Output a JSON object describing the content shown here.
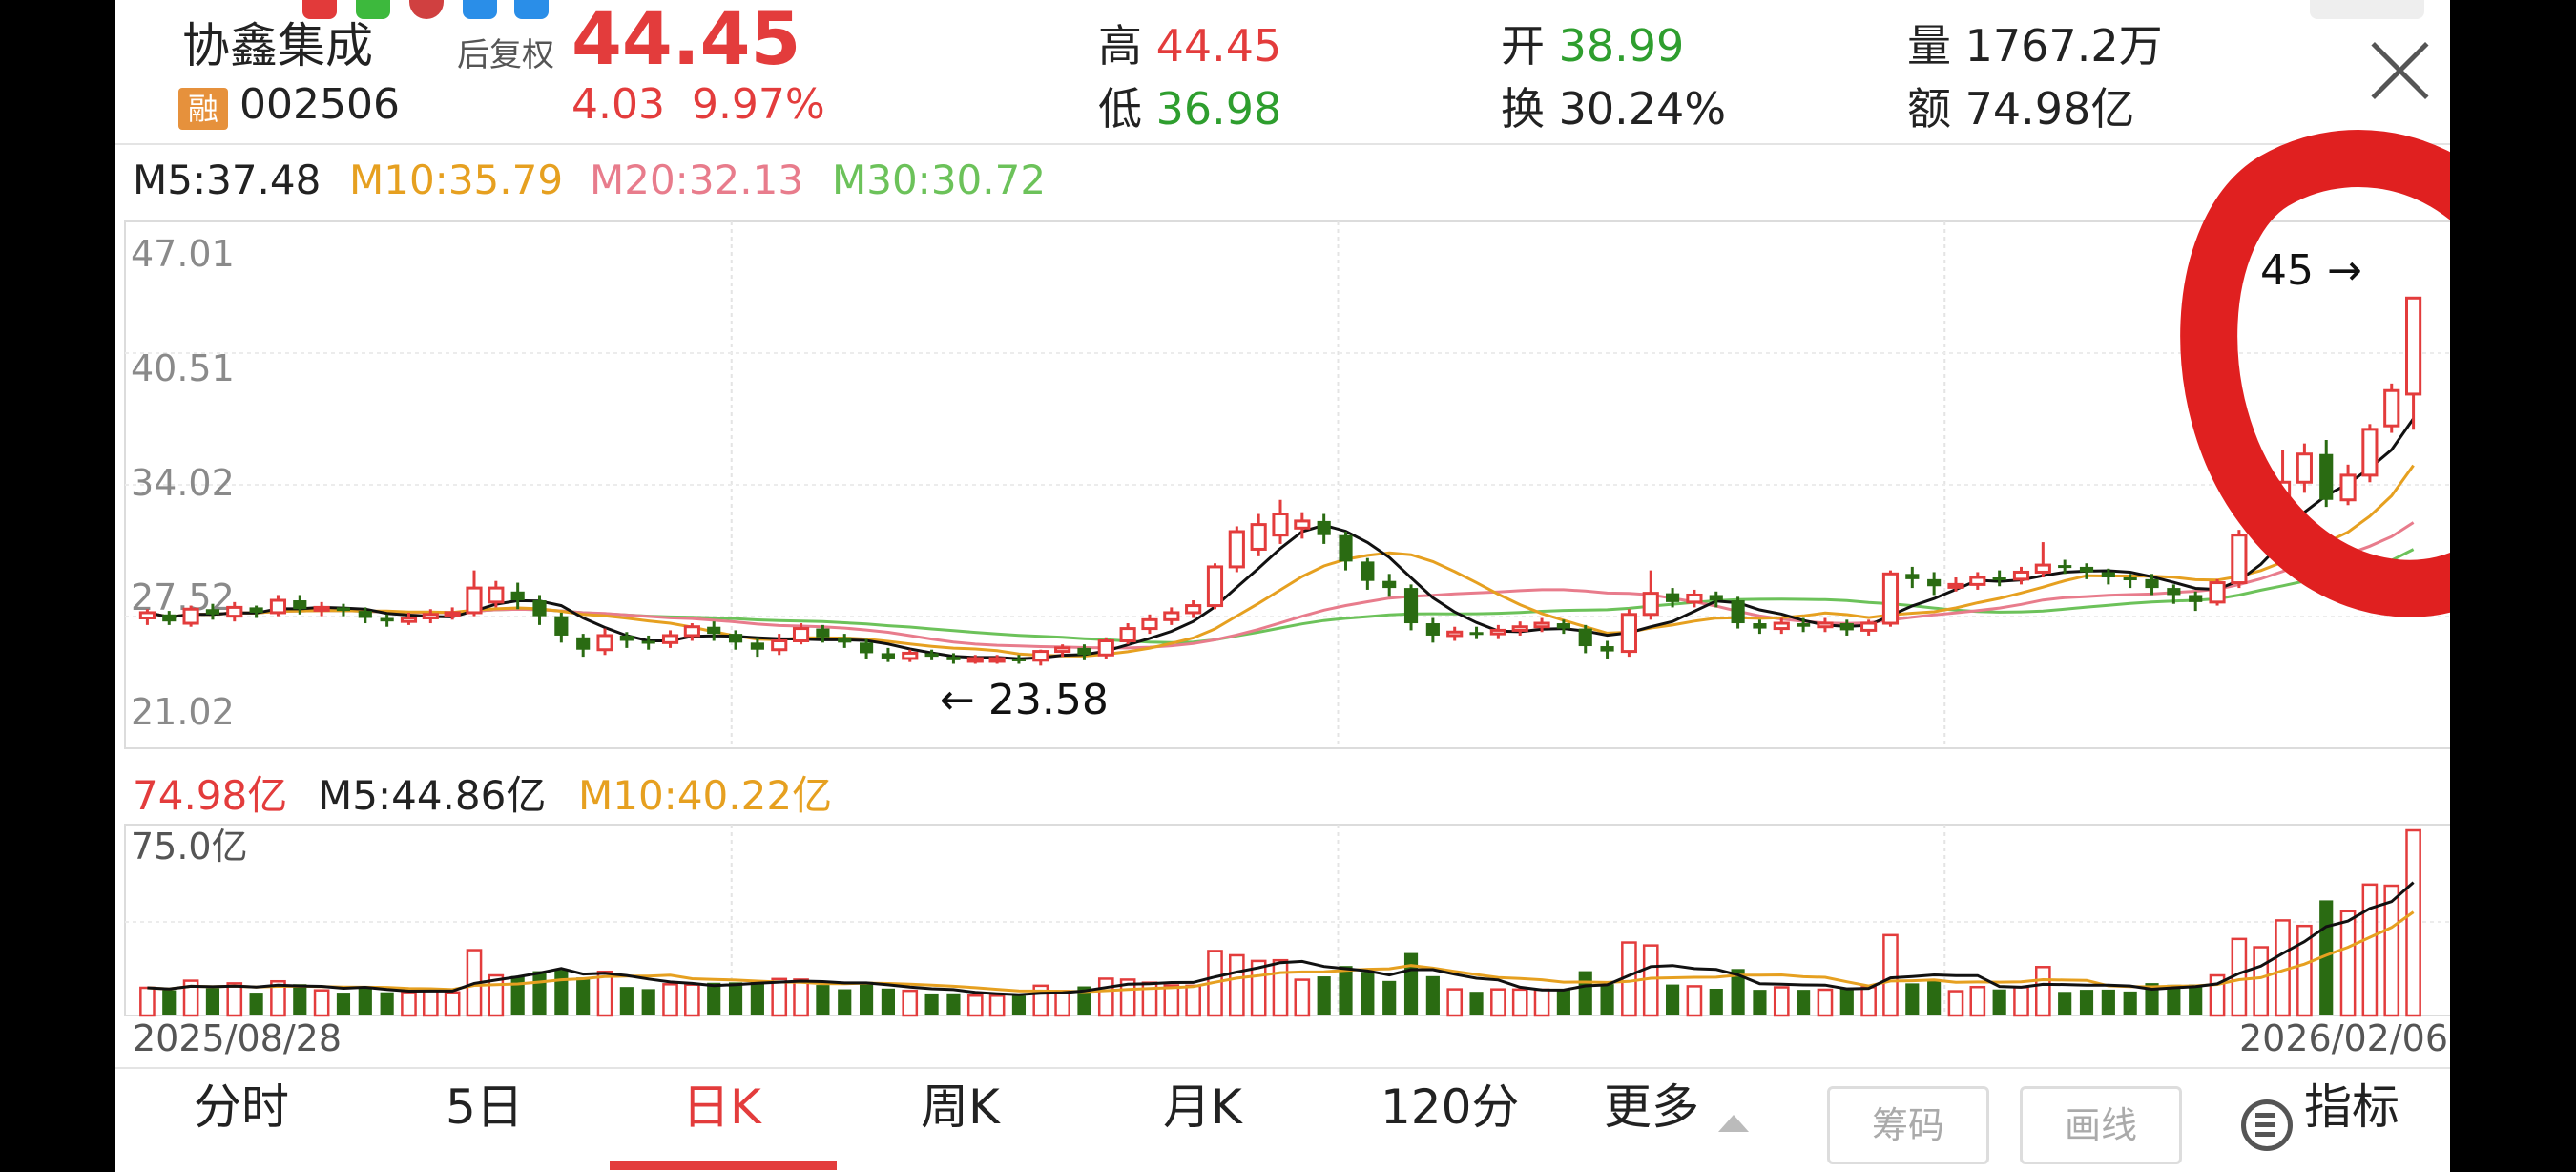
{
  "stock": {
    "name": "协鑫集成",
    "rong": "融",
    "code": "002506",
    "adjust_mode": "后复权",
    "price": "44.45",
    "change": "4.03",
    "change_pct": "9.97%"
  },
  "quote": {
    "high_label": "高",
    "high": "44.45",
    "low_label": "低",
    "low": "36.98",
    "open_label": "开",
    "open": "38.99",
    "turnover_label": "换",
    "turnover": "30.24%",
    "volume_label": "量",
    "volume": "1767.2万",
    "amount_label": "额",
    "amount": "74.98亿"
  },
  "ma_price": {
    "m5": "M5:37.48",
    "m10": "M10:35.79",
    "m20": "M20:32.13",
    "m30": "M30:30.72"
  },
  "chart_axis": {
    "y_ticks": [
      "47.01",
      "40.51",
      "34.02",
      "27.52",
      "21.02"
    ],
    "min_marker": "← 23.58",
    "max_marker": "45 →",
    "vol_max": "75.0亿",
    "date_start": "2025/08/28",
    "date_end": "2026/02/06"
  },
  "volume_ma": {
    "current": "74.98亿",
    "m5": "M5:44.86亿",
    "m10": "M10:40.22亿"
  },
  "colors": {
    "up": "#e33c3c",
    "down": "#2a6b12",
    "ma5": "#111111",
    "ma10": "#e6a020",
    "ma20": "#e87c8c",
    "ma30": "#6cc25a",
    "annotation": "#e02020"
  },
  "tabs": [
    {
      "label": "分时"
    },
    {
      "label": "5日"
    },
    {
      "label": "日K"
    },
    {
      "label": "周K"
    },
    {
      "label": "月K"
    },
    {
      "label": "120分"
    },
    {
      "label": "更多"
    }
  ],
  "buttons": {
    "chips": "筹码",
    "draw": "画线",
    "indicator": "指标"
  },
  "chart_data": {
    "type": "candlestick",
    "x_range": [
      "2025/08/28",
      "2026/02/06"
    ],
    "ylim": [
      21.02,
      47.01
    ],
    "candles": [
      [
        26.3,
        26.6,
        25.9,
        26.8
      ],
      [
        26.5,
        26.1,
        25.9,
        26.7
      ],
      [
        26.0,
        26.8,
        25.8,
        27.0
      ],
      [
        26.8,
        26.5,
        26.2,
        27.1
      ],
      [
        26.4,
        26.9,
        26.1,
        27.2
      ],
      [
        26.9,
        26.6,
        26.3,
        27.0
      ],
      [
        26.6,
        27.3,
        26.4,
        27.6
      ],
      [
        27.3,
        26.8,
        26.5,
        27.6
      ],
      [
        26.8,
        26.9,
        26.4,
        27.2
      ],
      [
        26.9,
        26.7,
        26.4,
        27.1
      ],
      [
        26.7,
        26.3,
        26.0,
        26.9
      ],
      [
        26.3,
        26.1,
        25.8,
        26.5
      ],
      [
        26.1,
        26.3,
        25.9,
        26.6
      ],
      [
        26.3,
        26.5,
        26.0,
        26.8
      ],
      [
        26.5,
        26.6,
        26.2,
        26.9
      ],
      [
        26.6,
        28.0,
        26.4,
        29.0
      ],
      [
        27.2,
        28.0,
        26.9,
        28.4
      ],
      [
        27.8,
        27.3,
        26.8,
        28.3
      ],
      [
        27.3,
        26.4,
        25.9,
        27.6
      ],
      [
        26.4,
        25.3,
        24.9,
        26.6
      ],
      [
        25.2,
        24.5,
        24.1,
        25.4
      ],
      [
        24.5,
        25.3,
        24.2,
        25.7
      ],
      [
        25.3,
        25.0,
        24.6,
        25.5
      ],
      [
        25.0,
        24.9,
        24.5,
        25.3
      ],
      [
        24.9,
        25.3,
        24.6,
        25.6
      ],
      [
        25.3,
        25.8,
        25.0,
        26.0
      ],
      [
        25.8,
        25.4,
        25.0,
        26.1
      ],
      [
        25.4,
        24.9,
        24.5,
        25.6
      ],
      [
        24.9,
        24.5,
        24.1,
        25.2
      ],
      [
        24.5,
        25.0,
        24.2,
        25.4
      ],
      [
        25.0,
        25.7,
        24.8,
        26.0
      ],
      [
        25.7,
        25.2,
        24.9,
        25.9
      ],
      [
        25.2,
        24.9,
        24.6,
        25.4
      ],
      [
        24.9,
        24.3,
        24.0,
        25.1
      ],
      [
        24.3,
        24.0,
        23.8,
        24.6
      ],
      [
        24.0,
        24.3,
        23.8,
        24.5
      ],
      [
        24.3,
        24.1,
        23.9,
        24.5
      ],
      [
        24.1,
        23.9,
        23.7,
        24.3
      ],
      [
        23.9,
        24.0,
        23.7,
        24.2
      ],
      [
        24.0,
        24.0,
        23.7,
        24.2
      ],
      [
        24.0,
        23.9,
        23.7,
        24.2
      ],
      [
        23.9,
        24.4,
        23.6,
        24.5
      ],
      [
        24.4,
        24.6,
        24.1,
        24.8
      ],
      [
        24.6,
        24.2,
        23.9,
        24.8
      ],
      [
        24.2,
        25.0,
        24.0,
        25.2
      ],
      [
        25.0,
        25.7,
        24.8,
        26.0
      ],
      [
        25.7,
        26.2,
        25.4,
        26.5
      ],
      [
        26.2,
        26.6,
        25.9,
        26.9
      ],
      [
        26.6,
        27.0,
        26.3,
        27.3
      ],
      [
        27.0,
        29.2,
        26.8,
        29.4
      ],
      [
        29.2,
        31.2,
        28.9,
        31.5
      ],
      [
        30.2,
        31.6,
        29.8,
        32.2
      ],
      [
        31.0,
        32.2,
        30.5,
        33.0
      ],
      [
        31.4,
        31.8,
        30.8,
        32.3
      ],
      [
        31.8,
        31.0,
        30.5,
        32.2
      ],
      [
        31.0,
        29.5,
        29.0,
        31.2
      ],
      [
        29.5,
        28.4,
        27.9,
        29.7
      ],
      [
        28.4,
        28.0,
        27.5,
        28.8
      ],
      [
        28.0,
        26.0,
        25.6,
        28.2
      ],
      [
        26.0,
        25.3,
        24.9,
        26.3
      ],
      [
        25.3,
        25.5,
        25.0,
        25.8
      ],
      [
        25.5,
        25.4,
        25.1,
        25.8
      ],
      [
        25.4,
        25.6,
        25.1,
        25.9
      ],
      [
        25.6,
        25.8,
        25.3,
        26.1
      ],
      [
        25.8,
        26.0,
        25.5,
        26.3
      ],
      [
        26.0,
        25.7,
        25.4,
        26.2
      ],
      [
        25.7,
        24.7,
        24.3,
        25.9
      ],
      [
        24.7,
        24.4,
        24.0,
        25.0
      ],
      [
        24.4,
        26.5,
        24.1,
        26.8
      ],
      [
        26.5,
        27.7,
        26.2,
        29.0
      ],
      [
        27.7,
        27.2,
        26.9,
        28.0
      ],
      [
        27.2,
        27.6,
        26.9,
        27.9
      ],
      [
        27.6,
        27.3,
        26.9,
        27.8
      ],
      [
        27.3,
        26.0,
        25.7,
        27.5
      ],
      [
        26.0,
        25.7,
        25.4,
        26.2
      ],
      [
        25.7,
        26.0,
        25.4,
        26.3
      ],
      [
        26.0,
        25.8,
        25.5,
        26.3
      ],
      [
        25.8,
        26.0,
        25.5,
        26.3
      ],
      [
        26.0,
        25.6,
        25.3,
        26.2
      ],
      [
        25.6,
        26.0,
        25.3,
        26.2
      ],
      [
        26.0,
        28.8,
        25.8,
        29.0
      ],
      [
        28.8,
        28.5,
        28.0,
        29.2
      ],
      [
        28.5,
        28.1,
        27.6,
        28.9
      ],
      [
        28.1,
        28.2,
        27.8,
        28.6
      ],
      [
        28.2,
        28.6,
        27.9,
        28.9
      ],
      [
        28.6,
        28.5,
        28.1,
        29.0
      ],
      [
        28.5,
        28.9,
        28.2,
        29.2
      ],
      [
        28.9,
        29.3,
        28.6,
        30.6
      ],
      [
        29.3,
        29.2,
        28.8,
        29.6
      ],
      [
        29.2,
        28.9,
        28.5,
        29.4
      ],
      [
        28.9,
        28.6,
        28.2,
        29.1
      ],
      [
        28.6,
        28.5,
        28.0,
        28.8
      ],
      [
        28.5,
        28.0,
        27.6,
        28.8
      ],
      [
        28.0,
        27.6,
        27.1,
        28.2
      ],
      [
        27.6,
        27.2,
        26.7,
        27.8
      ],
      [
        27.2,
        28.3,
        27.0,
        28.5
      ],
      [
        28.3,
        31.0,
        28.0,
        31.3
      ],
      [
        31.0,
        32.6,
        30.6,
        33.2
      ],
      [
        32.6,
        34.0,
        32.2,
        35.8
      ],
      [
        34.0,
        35.6,
        33.4,
        36.2
      ],
      [
        35.6,
        33.0,
        32.6,
        36.4
      ],
      [
        33.0,
        34.4,
        32.7,
        35.0
      ],
      [
        34.4,
        37.0,
        34.0,
        37.3
      ],
      [
        37.2,
        39.2,
        36.8,
        39.6
      ],
      [
        39.0,
        44.45,
        36.98,
        44.45
      ]
    ],
    "volume_max": "75.0亿"
  }
}
